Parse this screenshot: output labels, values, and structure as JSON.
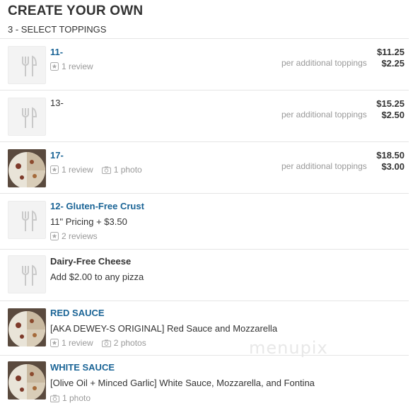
{
  "header": {
    "title": "CREATE YOUR OWN",
    "subtitle": "3 - SELECT TOPPINGS"
  },
  "items": [
    {
      "name": "11-",
      "name_is_link": true,
      "reviews": "1 review",
      "per_additional": "per additional toppings",
      "price_main": "$11.25",
      "price_additional": "$2.25",
      "thumb": "fork-knife-icon"
    },
    {
      "name": "13-",
      "name_is_link": false,
      "per_additional": "per additional toppings",
      "price_main": "$15.25",
      "price_additional": "$2.50",
      "thumb": "fork-knife-icon"
    },
    {
      "name": "17-",
      "name_is_link": true,
      "reviews": "1 review",
      "photos": "1 photo",
      "per_additional": "per additional toppings",
      "price_main": "$18.50",
      "price_additional": "$3.00",
      "thumb": "pizza-photo"
    },
    {
      "name": "12- Gluten-Free Crust",
      "name_is_link": true,
      "description": "11\" Pricing + $3.50",
      "reviews": "2 reviews",
      "thumb": "fork-knife-icon"
    },
    {
      "name": "Dairy-Free Cheese",
      "name_is_link": false,
      "description": "Add $2.00 to any pizza",
      "thumb": "fork-knife-icon"
    },
    {
      "name": "RED SAUCE",
      "name_is_link": true,
      "description": "[AKA DEWEY-S ORIGINAL] Red Sauce and Mozzarella",
      "reviews": "1 review",
      "photos": "2 photos",
      "thumb": "pizza-photo"
    },
    {
      "name": "WHITE SAUCE",
      "name_is_link": true,
      "description": "[Olive Oil + Minced Garlic] White Sauce, Mozzarella, and Fontina",
      "photos": "1 photo",
      "thumb": "pizza-photo"
    }
  ],
  "watermark": "menupix",
  "colors": {
    "link": "#1a6496",
    "meta": "#999999",
    "divider": "#e5e5e5"
  }
}
